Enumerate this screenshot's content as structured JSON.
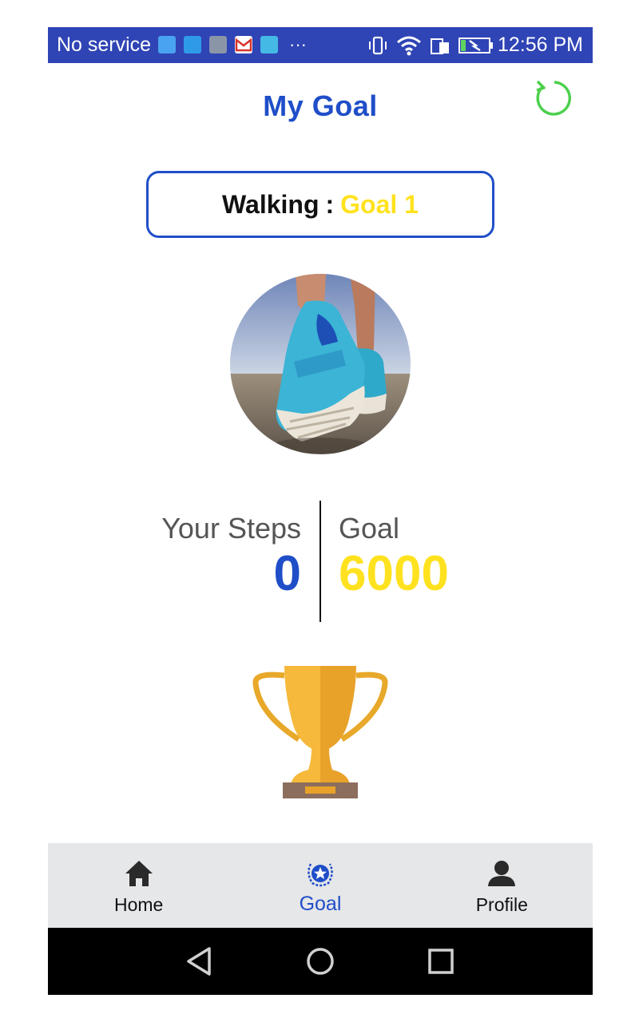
{
  "status_bar": {
    "carrier": "No service",
    "time": "12:56 PM",
    "more": "···"
  },
  "header": {
    "title": "My Goal"
  },
  "goal_selector": {
    "activity": "Walking",
    "separator": ":",
    "goal_name": "Goal 1"
  },
  "stats": {
    "steps_label": "Your Steps",
    "steps_value": "0",
    "goal_label": "Goal",
    "goal_value": "6000"
  },
  "bottom_nav": {
    "items": [
      {
        "label": "Home",
        "icon": "home-icon"
      },
      {
        "label": "Goal",
        "icon": "goal-star-icon"
      },
      {
        "label": "Profile",
        "icon": "person-icon"
      }
    ],
    "active": "Goal"
  },
  "colors": {
    "primary_blue": "#1f4ec8",
    "status_bar_blue": "#2f44b5",
    "goal_yellow": "#ffe21f",
    "refresh_green": "#4cd04c",
    "nav_background": "#e6e7e9"
  }
}
